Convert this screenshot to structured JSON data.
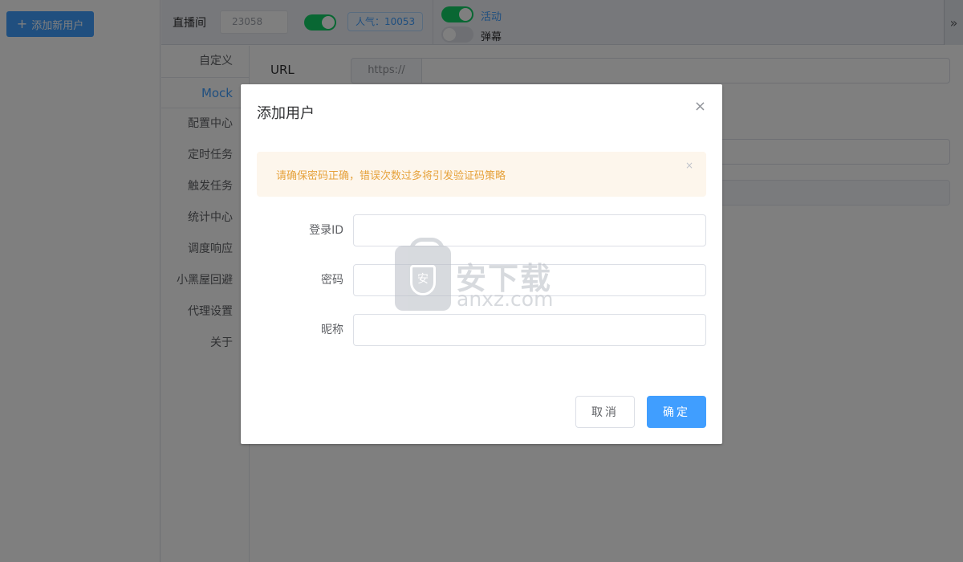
{
  "sidebar": {
    "add_user_label": "添加新用户"
  },
  "topbar": {
    "room_label": "直播间",
    "room_id": "23058",
    "popularity": "人气：10053",
    "activity_label": "活动",
    "danmu_label": "弹幕",
    "expand_icon": "»"
  },
  "nav": {
    "items": [
      "自定义",
      "Mock",
      "配置中心",
      "定时任务",
      "触发任务",
      "统计中心",
      "调度响应",
      "小黑屋回避",
      "代理设置",
      "关于"
    ]
  },
  "content": {
    "url_label": "URL",
    "url_prefix": "https://"
  },
  "dialog": {
    "title": "添加用户",
    "close_icon": "×",
    "alert_text": "请确保密码正确，错误次数过多将引发验证码策略",
    "alert_close_icon": "×",
    "fields": {
      "login_id": "登录ID",
      "password": "密码",
      "nickname": "昵称"
    },
    "cancel_label": "取消",
    "confirm_label": "确定"
  },
  "watermark": {
    "shield_text": "安",
    "cn_text": "安下载",
    "en_text": "anxz.com"
  },
  "colors": {
    "primary": "#409eff",
    "switch_on": "#13ce66",
    "warning": "#e6a23c"
  }
}
